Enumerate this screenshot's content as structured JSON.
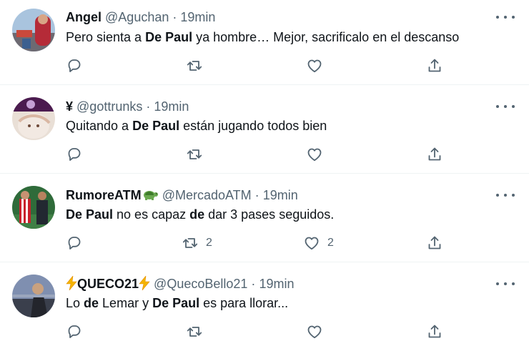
{
  "icons": {
    "reply": "reply-icon",
    "retweet": "retweet-icon",
    "like": "like-icon",
    "share": "share-icon",
    "more": "more-icon"
  },
  "colors": {
    "text": "#0f1419",
    "secondary": "#536471",
    "divider": "#eff3f4",
    "lightning": "#f4b400"
  },
  "tweets": [
    {
      "name": "Angel",
      "handle": "@Aguchan",
      "separator": "·",
      "time": "19min",
      "text": [
        {
          "t": "Pero sienta a "
        },
        {
          "t": "De Paul",
          "bold": true
        },
        {
          "t": " ya hombre… Mejor, sacrificalo en el descanso"
        }
      ],
      "retweets": "",
      "likes": ""
    },
    {
      "name": "¥",
      "handle": "@gottrunks",
      "separator": "·",
      "time": "19min",
      "text": [
        {
          "t": "Quitando a "
        },
        {
          "t": "De Paul",
          "bold": true
        },
        {
          "t": " están jugando todos bien"
        }
      ],
      "retweets": "",
      "likes": ""
    },
    {
      "name": "RumoreATM",
      "name_emoji": "turtle",
      "handle": "@MercadoATM",
      "separator": "·",
      "time": "19min",
      "text": [
        {
          "t": "De Paul",
          "bold": true
        },
        {
          "t": " no es capaz "
        },
        {
          "t": "de",
          "bold": true
        },
        {
          "t": " dar 3 pases seguidos."
        }
      ],
      "retweets": "2",
      "likes": "2"
    },
    {
      "name": "QUECO21",
      "name_emoji": "lightning",
      "handle": "@QuecoBello21",
      "separator": "·",
      "time": "19min",
      "text": [
        {
          "t": "Lo "
        },
        {
          "t": "de",
          "bold": true
        },
        {
          "t": " Lemar y "
        },
        {
          "t": "De Paul",
          "bold": true
        },
        {
          "t": " es para llorar..."
        }
      ],
      "retweets": "",
      "likes": ""
    }
  ]
}
